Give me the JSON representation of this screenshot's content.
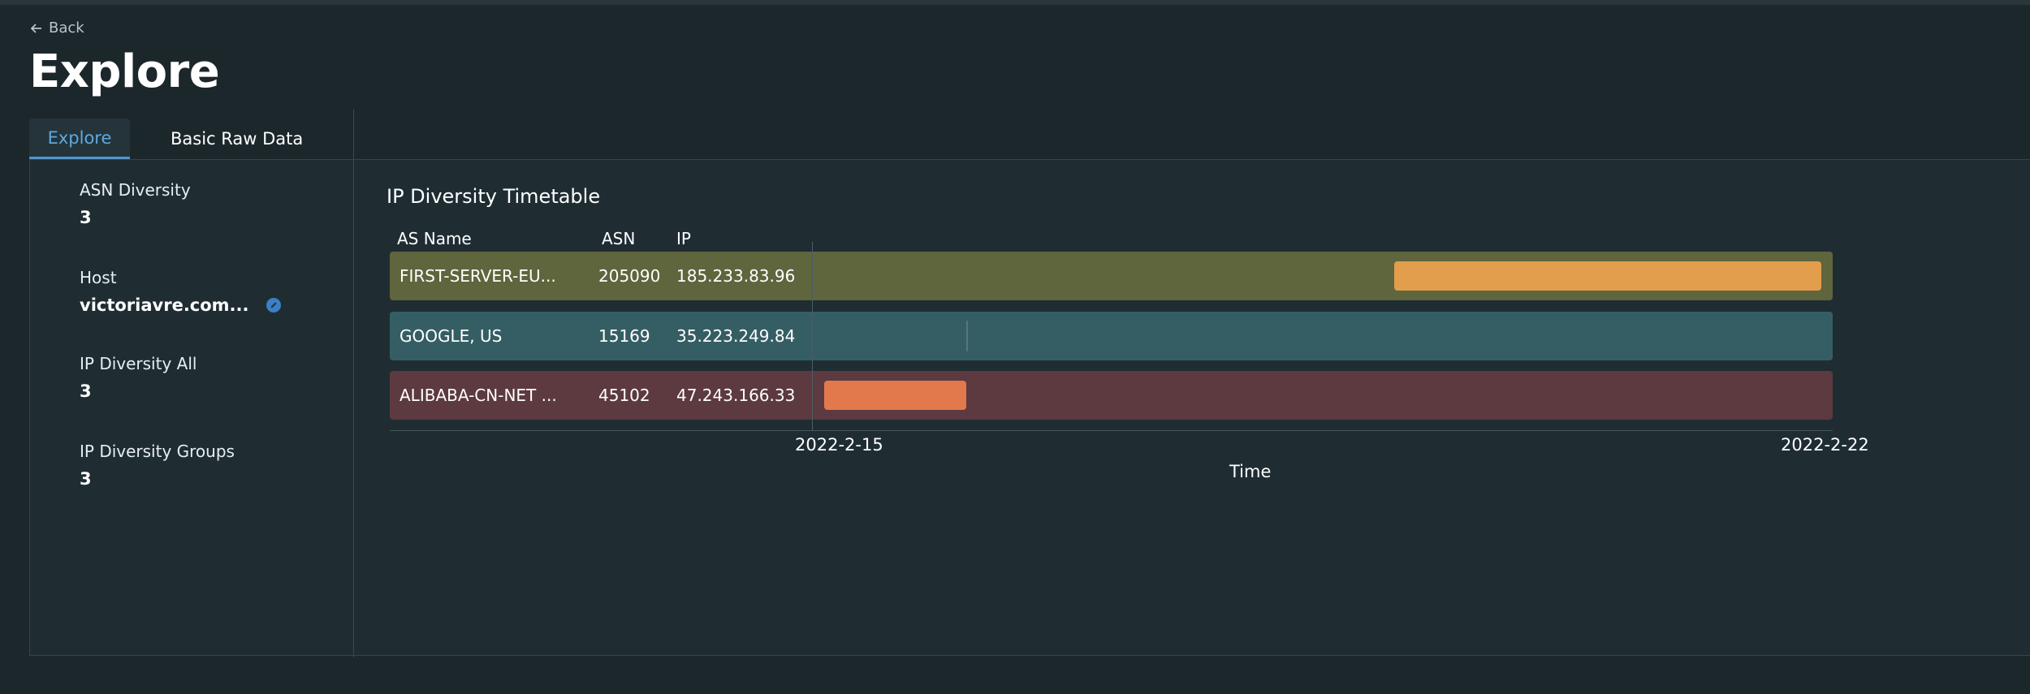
{
  "nav": {
    "back_label": "Back"
  },
  "page": {
    "title": "Explore"
  },
  "tabs": [
    {
      "label": "Explore",
      "active": true
    },
    {
      "label": "Basic Raw Data",
      "active": false
    }
  ],
  "stats": [
    {
      "label": "ASN Diversity",
      "value": "3"
    },
    {
      "label": "Host",
      "value": "victoriavre.com..."
    },
    {
      "label": "IP Diversity All",
      "value": "3"
    },
    {
      "label": "IP Diversity Groups",
      "value": "3"
    }
  ],
  "chart_data": {
    "type": "timeline",
    "title": "IP Diversity Timetable",
    "columns": [
      "AS Name",
      "ASN",
      "IP"
    ],
    "xlabel": "Time",
    "x_ticks": [
      "2022-2-15",
      "2022-2-22"
    ],
    "rows": [
      {
        "as_name": "FIRST-SERVER-EU...",
        "asn": "205090",
        "ip": "185.233.83.96",
        "start": "2022-2-19",
        "end": "2022-2-22",
        "row_color": "#5f653c",
        "bar_color": "#e29e4c"
      },
      {
        "as_name": "GOOGLE, US",
        "asn": "15169",
        "ip": "35.223.249.84",
        "start": "2022-2-16",
        "end": "2022-2-16",
        "row_color": "#355e64",
        "bar_color": "#53777d"
      },
      {
        "as_name": "ALIBABA-CN-NET ...",
        "asn": "45102",
        "ip": "47.243.166.33",
        "start": "2022-2-15",
        "end": "2022-2-16",
        "row_color": "#5c3a3f",
        "bar_color": "#e2794c"
      }
    ]
  }
}
